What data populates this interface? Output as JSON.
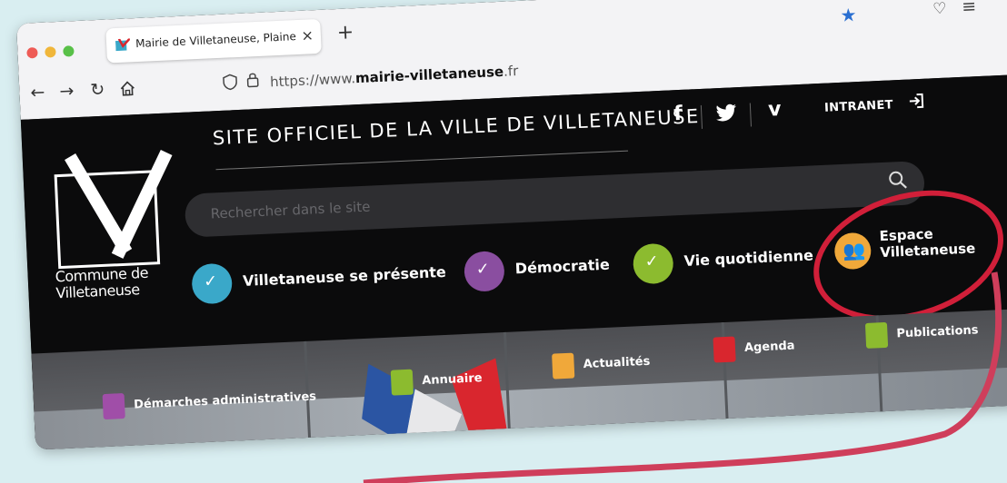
{
  "browser": {
    "tab_title": "Mairie de Villetaneuse, Plaine C",
    "tab_close": "×",
    "new_tab": "+",
    "url_prefix": "https://www.",
    "url_domain": "mairie-villetaneuse",
    "url_suffix": ".fr",
    "icons": [
      "back-icon",
      "forward-icon",
      "reload-icon",
      "home-icon",
      "shield-icon",
      "lock-icon",
      "bookmark-star-icon",
      "pocket-icon",
      "menu-icon"
    ]
  },
  "site": {
    "logo_text": "Commune de\nVilletaneuse",
    "title": "SITE OFFICIEL DE LA VILLE DE VILLETANEUSE",
    "social": [
      "f",
      "t",
      "v"
    ],
    "intranet": "INTRANET",
    "search_placeholder": "Rechercher dans le site",
    "main_nav": [
      {
        "label": "Villetaneuse se présente",
        "color": "#3aa8c9"
      },
      {
        "label": "Démocratie",
        "color": "#8a4ea0"
      },
      {
        "label": "Vie quotidienne",
        "color": "#8cbb2f"
      }
    ],
    "espace": {
      "label": "Espace\nVilletaneuse",
      "color": "#f0a83a"
    },
    "sub_nav": [
      {
        "label": "Démarches administratives",
        "color": "#a04ea8"
      },
      {
        "label": "Annuaire",
        "color": "#8cbb2f"
      },
      {
        "label": "Actualités",
        "color": "#f0a83a"
      },
      {
        "label": "Agenda",
        "color": "#d9262e"
      },
      {
        "label": "Publications",
        "color": "#8cbb2f"
      }
    ]
  },
  "highlight_color": "#d11f39"
}
